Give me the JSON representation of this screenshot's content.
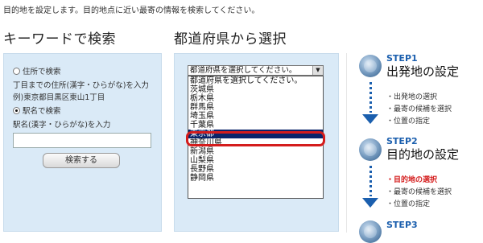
{
  "intro": "目的地を設定します。目的地点に近い最寄の情報を検索してください。",
  "keyword": {
    "heading": "キーワードで検索",
    "address_radio_label": "住所で検索",
    "address_hint": "丁目までの住所(漢字・ひらがな)を入力",
    "address_example": "例)東京都目黒区東山1丁目",
    "station_radio_label": "駅名で検索",
    "station_hint": "駅名(漢字・ひらがな)を入力",
    "input_value": "",
    "search_button": "検索する"
  },
  "prefecture": {
    "heading": "都道府県から選択",
    "select_value": "都道府県を選択してください。",
    "options": [
      "都道府県を選択してください。",
      "茨城県",
      "栃木県",
      "群馬県",
      "埼玉県",
      "千葉県",
      "東京都",
      "神奈川県",
      "新潟県",
      "山梨県",
      "長野県",
      "静岡県"
    ],
    "selected": "東京都"
  },
  "steps": [
    {
      "label": "STEP1",
      "title": "出発地の設定",
      "bullets": [
        "出発地の選択",
        "最寄の候補を選択",
        "位置の指定"
      ],
      "active": -1
    },
    {
      "label": "STEP2",
      "title": "目的地の設定",
      "bullets": [
        "目的地の選択",
        "最寄の候補を選択",
        "位置の指定"
      ],
      "active": 0
    },
    {
      "label": "STEP3",
      "title": "",
      "bullets": [],
      "active": -1
    }
  ],
  "colors": {
    "panel_bg": "#daeaf7",
    "accent_blue": "#1b5fae",
    "highlight_red": "#d41c1c",
    "selected_bg": "#0a246a"
  }
}
